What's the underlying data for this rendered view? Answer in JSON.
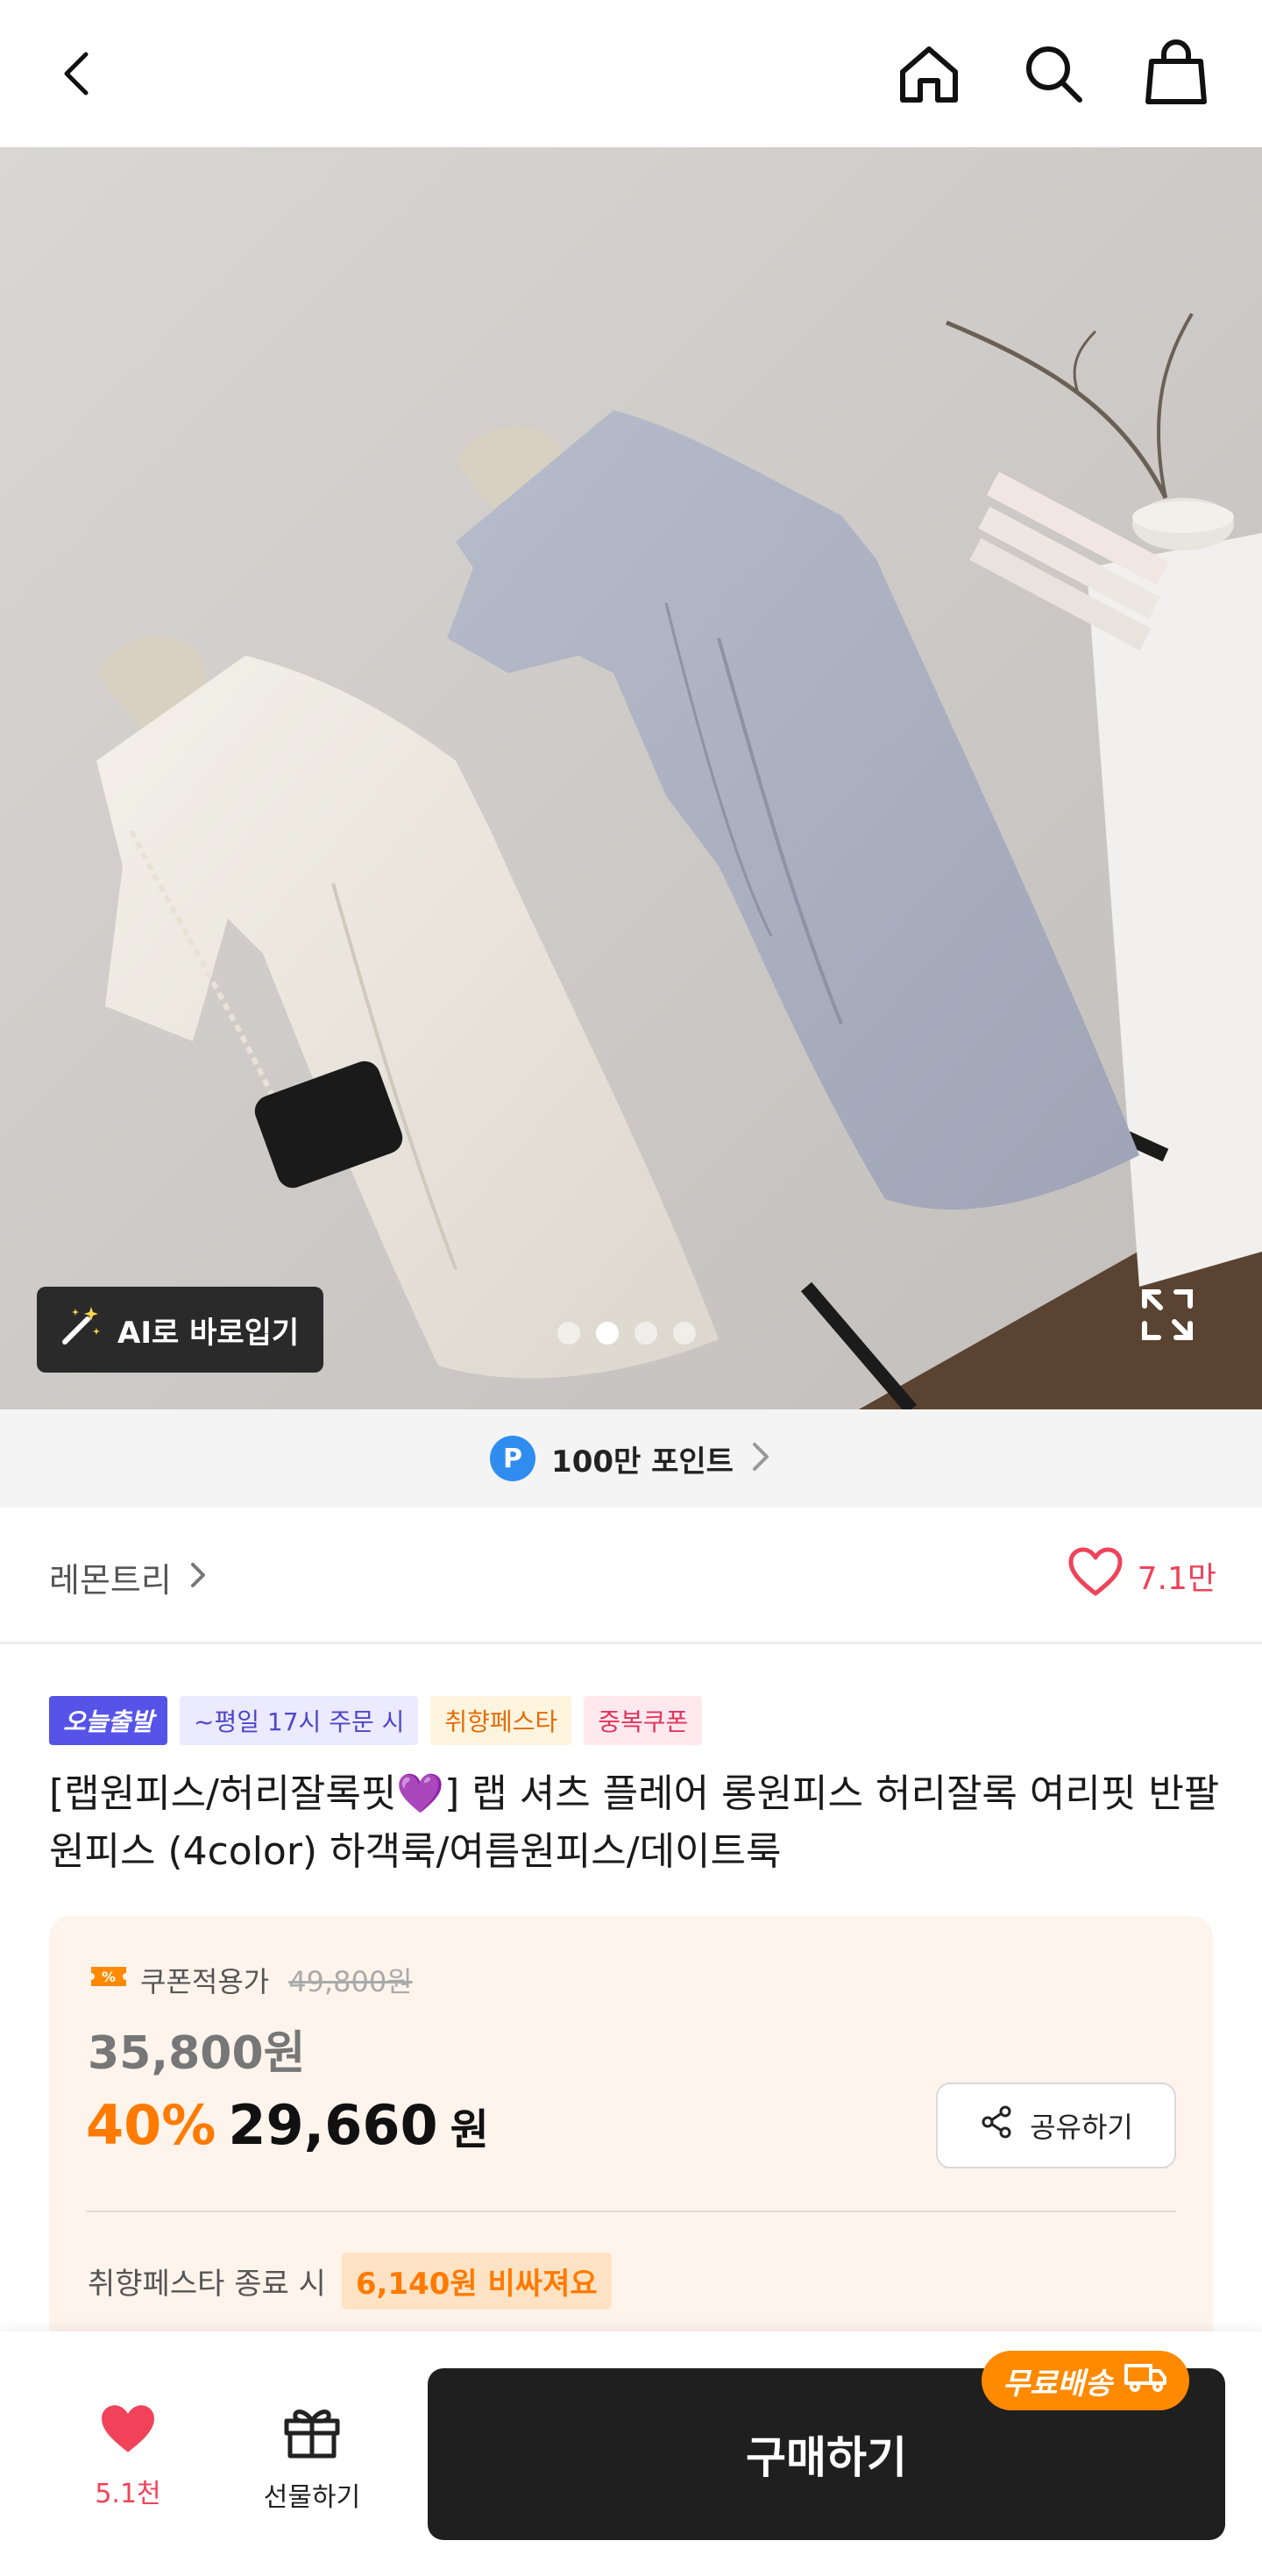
{
  "header": {
    "icons": [
      "back-icon",
      "home-icon",
      "search-icon",
      "shopping-bag-icon"
    ]
  },
  "hero": {
    "ai_button_label": "AI로 바로입기",
    "slide_count": 4,
    "active_slide_index": 1
  },
  "points_banner": {
    "badge": "P",
    "label": "100만 포인트"
  },
  "store": {
    "name": "레몬트리",
    "like_count": "7.1만"
  },
  "badges": [
    {
      "label": "오늘출발"
    },
    {
      "label": "~평일 17시 주문 시"
    },
    {
      "label": "취향페스타"
    },
    {
      "label": "중복쿠폰"
    }
  ],
  "product": {
    "title": "[랩원피스/허리잘록핏💜] 랩 셔츠 플레어 롱원피스 허리잘록 여리핏 반팔원피스 (4color) 하객룩/여름원피스/데이트룩"
  },
  "price": {
    "coupon_label": "쿠폰적용가",
    "original_price": "49,800원",
    "sale_price": "35,800원",
    "discount_percent": "40%",
    "final_price": "29,660",
    "currency": "원",
    "share_label": "공유하기",
    "festa_label": "취향페스타 종료 시",
    "festa_warning": "6,140원 비싸져요"
  },
  "bottom_bar": {
    "like_count": "5.1천",
    "gift_label": "선물하기",
    "buy_label": "구매하기",
    "free_shipping_label": "무료배송"
  },
  "colors": {
    "accent_orange": "#ff7a00",
    "like_red": "#f0435a",
    "point_blue": "#2f8df0",
    "buy_button": "#1f1f1f"
  }
}
